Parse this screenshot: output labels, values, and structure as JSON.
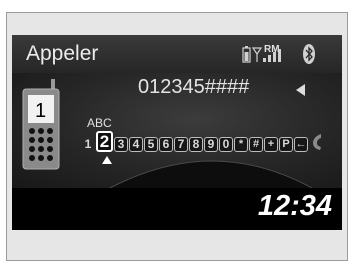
{
  "header": {
    "title": "Appeler",
    "status": {
      "battery_icon": "battery-icon",
      "signal_icon": "signal-icon",
      "roaming_label": "RM",
      "bluetooth_icon": "bluetooth-icon"
    }
  },
  "dial": {
    "number": "012345####",
    "backspace_icon": "left-arrow-icon",
    "phone_icon": "mobile-phone-icon",
    "phone_index": "1"
  },
  "keypad": {
    "selected_letters": "ABC",
    "keys": [
      {
        "label": "1",
        "selected": false
      },
      {
        "label": "2",
        "selected": true
      },
      {
        "label": "3",
        "selected": false
      },
      {
        "label": "4",
        "selected": false
      },
      {
        "label": "5",
        "selected": false
      },
      {
        "label": "6",
        "selected": false
      },
      {
        "label": "7",
        "selected": false
      },
      {
        "label": "8",
        "selected": false
      },
      {
        "label": "9",
        "selected": false
      },
      {
        "label": "0",
        "selected": false
      },
      {
        "label": "*",
        "selected": false
      },
      {
        "label": "#",
        "selected": false
      },
      {
        "label": "+",
        "selected": false
      },
      {
        "label": "P",
        "selected": false
      },
      {
        "label": "←",
        "selected": false
      }
    ],
    "call_icon": "handset-icon",
    "cursor_icon": "up-triangle-icon"
  },
  "clock": {
    "time": "12:34"
  },
  "colors": {
    "screen_background": "#000000",
    "text": "#ffffff",
    "frame_background": "#e6e6e6"
  }
}
